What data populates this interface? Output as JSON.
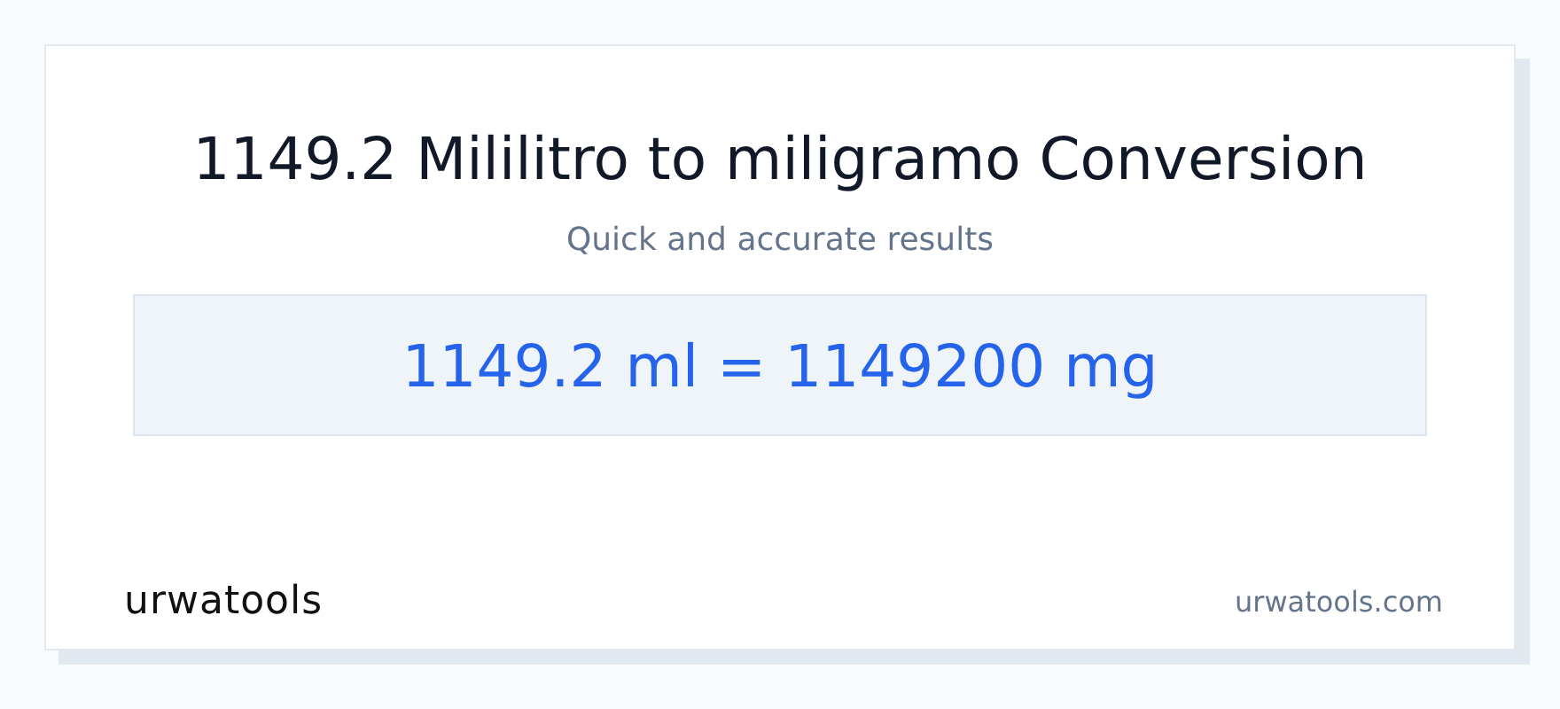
{
  "title": "1149.2 Mililitro to miligramo Conversion",
  "subtitle": "Quick and accurate results",
  "result": "1149.2 ml = 1149200 mg",
  "footer": {
    "logo": "urwatools",
    "site": "urwatools.com"
  }
}
